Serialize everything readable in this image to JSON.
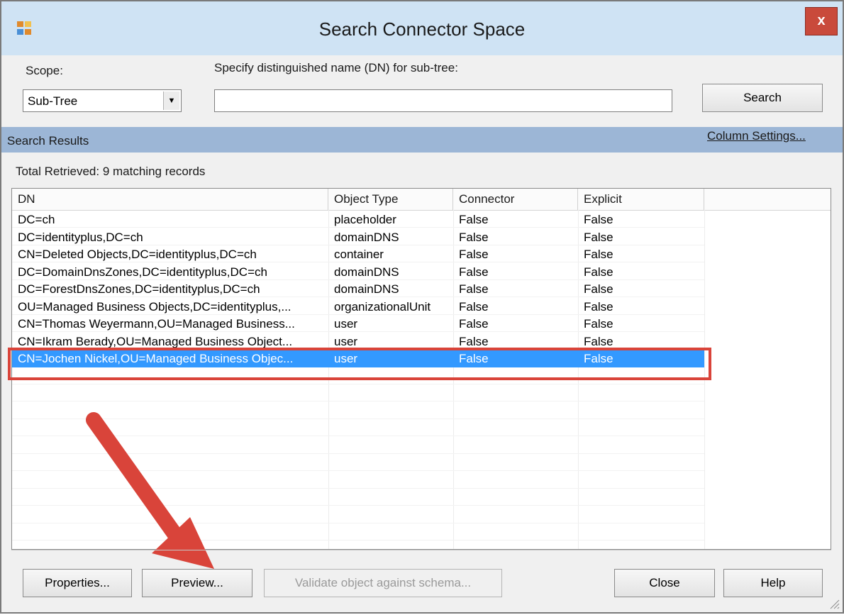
{
  "window": {
    "title": "Search Connector Space",
    "close_glyph": "x",
    "app_icon": "connector-app-icon"
  },
  "scope": {
    "label": "Scope:",
    "selected": "Sub-Tree",
    "dropdown_glyph": "▼"
  },
  "dn": {
    "label": "Specify distinguished name (DN) for sub-tree:",
    "value": ""
  },
  "search_button": "Search",
  "results": {
    "header": "Search Results",
    "column_settings_link": "Column Settings...",
    "total": "Total Retrieved: 9 matching records"
  },
  "table": {
    "columns": [
      "DN",
      "Object Type",
      "Connector",
      "Explicit"
    ],
    "rows": [
      [
        "DC=ch",
        "placeholder",
        "False",
        "False"
      ],
      [
        "DC=identityplus,DC=ch",
        "domainDNS",
        "False",
        "False"
      ],
      [
        "CN=Deleted Objects,DC=identityplus,DC=ch",
        "container",
        "False",
        "False"
      ],
      [
        "DC=DomainDnsZones,DC=identityplus,DC=ch",
        "domainDNS",
        "False",
        "False"
      ],
      [
        "DC=ForestDnsZones,DC=identityplus,DC=ch",
        "domainDNS",
        "False",
        "False"
      ],
      [
        "OU=Managed Business Objects,DC=identityplus,...",
        "organizationalUnit",
        "False",
        "False"
      ],
      [
        "CN=Thomas Weyermann,OU=Managed Business...",
        "user",
        "False",
        "False"
      ],
      [
        "CN=Ikram Berady,OU=Managed Business Object...",
        "user",
        "False",
        "False"
      ],
      [
        "CN=Jochen Nickel,OU=Managed Business Objec...",
        "user",
        "False",
        "False"
      ]
    ],
    "selected_row": 8
  },
  "buttons": {
    "properties": "Properties...",
    "preview": "Preview...",
    "validate": "Validate object against schema...",
    "close": "Close",
    "help": "Help"
  },
  "colors": {
    "titlebar": "#cfe3f4",
    "close_button": "#c94a3b",
    "results_band": "#9cb6d6",
    "selection": "#3399ff",
    "annotation": "#d9443a"
  }
}
